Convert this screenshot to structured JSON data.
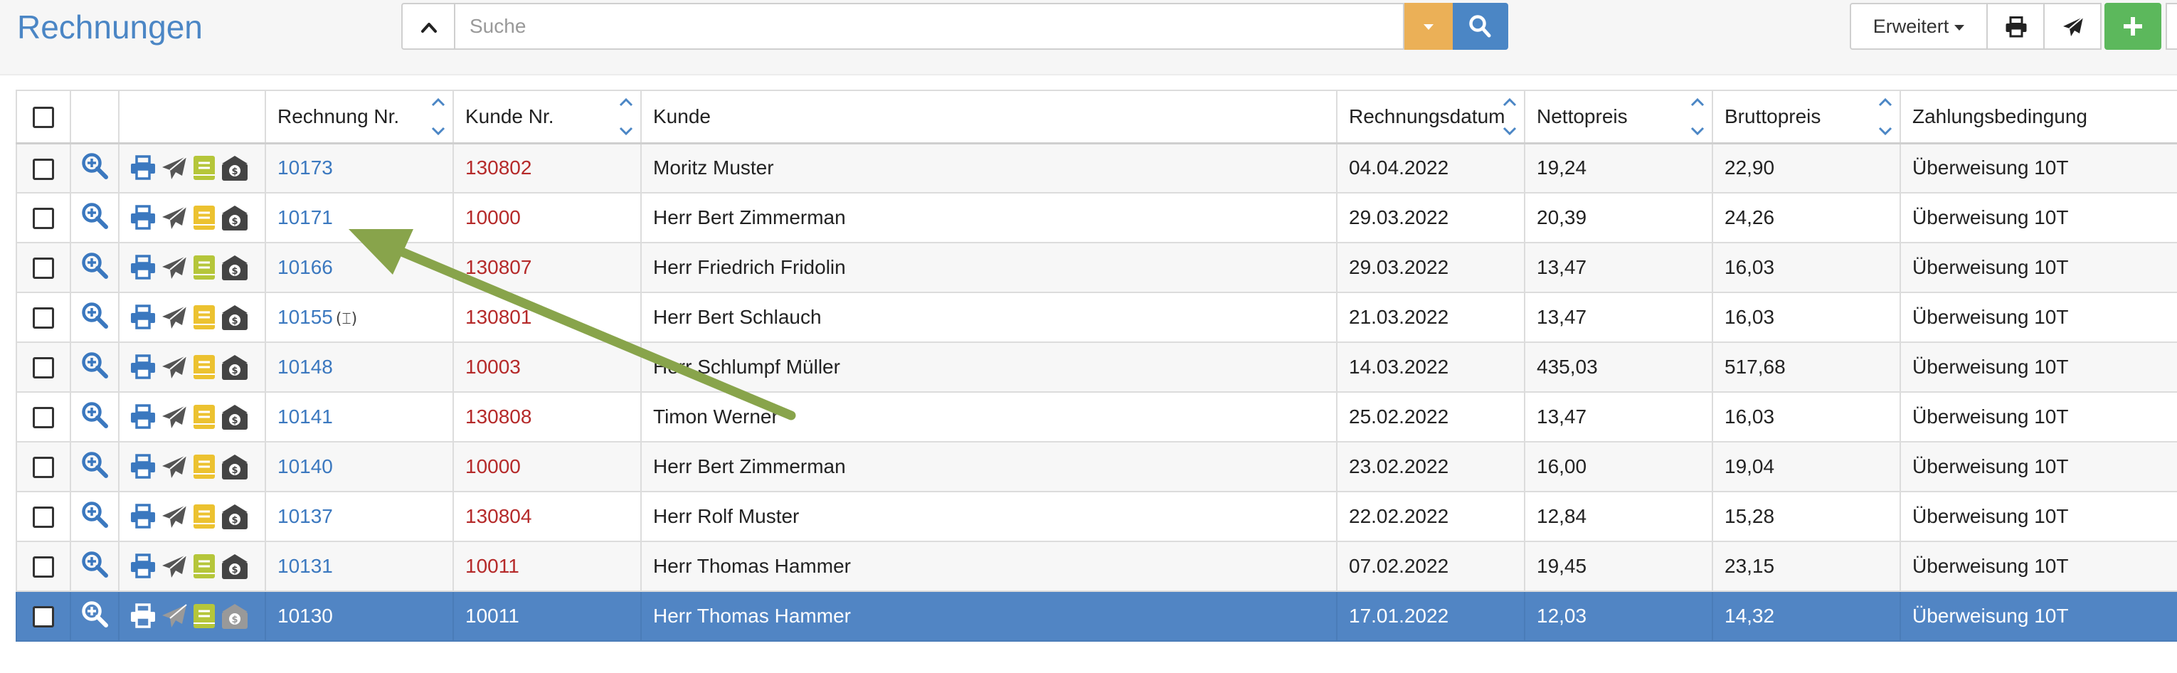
{
  "header": {
    "title": "Rechnungen",
    "search_placeholder": "Suche",
    "search_value": "",
    "erweitert_label": "Erweitert"
  },
  "columns": {
    "rechnung_nr": "Rechnung Nr.",
    "kunde_nr": "Kunde Nr.",
    "kunde": "Kunde",
    "rechnungsdatum": "Rechnungsdatum",
    "nettopreis": "Nettopreis",
    "bruttopreis": "Bruttopreis",
    "zahlungsbedingung": "Zahlungsbedingung"
  },
  "rows": [
    {
      "rechnung_nr": "10173",
      "kunde_nr": "130802",
      "kunde": "Moritz Muster",
      "datum": "04.04.2022",
      "netto": "19,24",
      "brutto": "22,90",
      "zahlung": "Überweisung 10T",
      "book_color": "#b5c63a",
      "dollar_color": "#444"
    },
    {
      "rechnung_nr": "10171",
      "kunde_nr": "10000",
      "kunde": "Herr Bert Zimmerman",
      "datum": "29.03.2022",
      "netto": "20,39",
      "brutto": "24,26",
      "zahlung": "Überweisung 10T",
      "book_color": "#ecc230",
      "dollar_color": "#444"
    },
    {
      "rechnung_nr": "10166",
      "kunde_nr": "130807",
      "kunde": "Herr Friedrich Fridolin",
      "datum": "29.03.2022",
      "netto": "13,47",
      "brutto": "16,03",
      "zahlung": "Überweisung 10T",
      "book_color": "#b5c63a",
      "dollar_color": "#444"
    },
    {
      "rechnung_nr": "10155",
      "log_marker": "(⌶)",
      "kunde_nr": "130801",
      "kunde": "Herr Bert Schlauch",
      "datum": "21.03.2022",
      "netto": "13,47",
      "brutto": "16,03",
      "zahlung": "Überweisung 10T",
      "book_color": "#ecc230",
      "dollar_color": "#444"
    },
    {
      "rechnung_nr": "10148",
      "kunde_nr": "10003",
      "kunde": "Herr Schlumpf Müller",
      "datum": "14.03.2022",
      "netto": "435,03",
      "brutto": "517,68",
      "zahlung": "Überweisung 10T",
      "book_color": "#ecc230",
      "dollar_color": "#444"
    },
    {
      "rechnung_nr": "10141",
      "kunde_nr": "130808",
      "kunde": "Timon Werner",
      "datum": "25.02.2022",
      "netto": "13,47",
      "brutto": "16,03",
      "zahlung": "Überweisung 10T",
      "book_color": "#ecc230",
      "dollar_color": "#444"
    },
    {
      "rechnung_nr": "10140",
      "kunde_nr": "10000",
      "kunde": "Herr Bert Zimmerman",
      "datum": "23.02.2022",
      "netto": "16,00",
      "brutto": "19,04",
      "zahlung": "Überweisung 10T",
      "book_color": "#ecc230",
      "dollar_color": "#444"
    },
    {
      "rechnung_nr": "10137",
      "kunde_nr": "130804",
      "kunde": "Herr Rolf Muster",
      "datum": "22.02.2022",
      "netto": "12,84",
      "brutto": "15,28",
      "zahlung": "Überweisung 10T",
      "book_color": "#ecc230",
      "dollar_color": "#444"
    },
    {
      "rechnung_nr": "10131",
      "kunde_nr": "10011",
      "kunde": "Herr Thomas Hammer",
      "datum": "07.02.2022",
      "netto": "19,45",
      "brutto": "23,15",
      "zahlung": "Überweisung 10T",
      "book_color": "#b5c63a",
      "dollar_color": "#444"
    },
    {
      "rechnung_nr": "10130",
      "kunde_nr": "10011",
      "kunde": "Herr Thomas Hammer",
      "datum": "17.01.2022",
      "netto": "12,03",
      "brutto": "14,32",
      "zahlung": "Überweisung 10T",
      "book_color": "#b5c63a",
      "dollar_color": "#999",
      "selected": true
    }
  ],
  "colors": {
    "title_blue": "#4b86c5",
    "link_blue": "#3b78bf",
    "customer_red": "#b52a2a",
    "selected_row": "#5185c4",
    "search_button": "#4b86c5",
    "dropdown_button": "#ebb057",
    "add_button": "#5cb85c",
    "annotation_arrow": "#88a44b"
  },
  "icons": {
    "collapse": "chevron-up-icon",
    "dropdown": "caret-down-icon",
    "search": "search-icon",
    "print": "print-icon",
    "send": "paper-plane-icon",
    "add": "plus-icon",
    "view": "zoom-in-icon",
    "book": "book-icon",
    "dollar": "money-envelope-icon"
  }
}
